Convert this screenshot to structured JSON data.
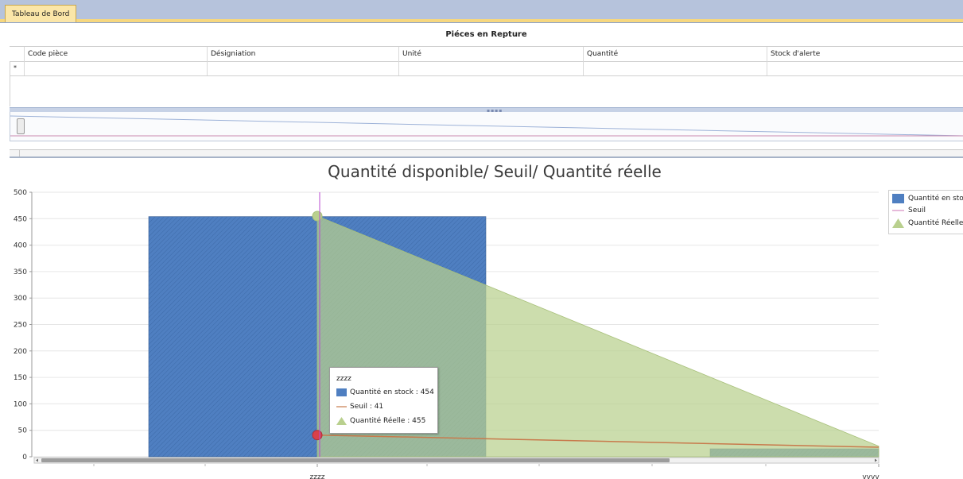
{
  "tab": {
    "label": "Tableau de Bord"
  },
  "grid": {
    "title": "Piéces en Repture",
    "columns": [
      "Code pièce",
      "Désigniation",
      "Unité",
      "Quantité",
      "Stock d'alerte"
    ],
    "new_row_marker": "*"
  },
  "colors": {
    "stock": "#4f7fc1",
    "seuil": "#c87a4c",
    "reelle": "#b9d08e",
    "cursor": "#b84bd1"
  },
  "chart_data": {
    "type": "bar",
    "title": "Quantité disponible/ Seuil/ Quantité réelle",
    "categories": [
      "zzzz",
      "vvvv"
    ],
    "series": [
      {
        "name": "Quantité en stock",
        "type": "bar",
        "values": [
          454,
          15
        ]
      },
      {
        "name": "Seuil",
        "type": "line",
        "values": [
          41,
          18
        ]
      },
      {
        "name": "Quantité Réelle",
        "type": "area",
        "values": [
          455,
          20
        ]
      }
    ],
    "ylim": [
      0,
      500
    ],
    "yticks": [
      "0",
      "50",
      "100",
      "150",
      "200",
      "250",
      "300",
      "350",
      "400",
      "450",
      "500"
    ],
    "grid": true,
    "legend_placement": "right",
    "legend": [
      "Quantité en stock",
      "Seuil",
      "Quantité Réelle"
    ],
    "tooltip": {
      "title": "zzzz",
      "rows": [
        "Quantité en stock : 454",
        "Seuil : 41",
        "Quantité Réelle : 455"
      ]
    }
  }
}
